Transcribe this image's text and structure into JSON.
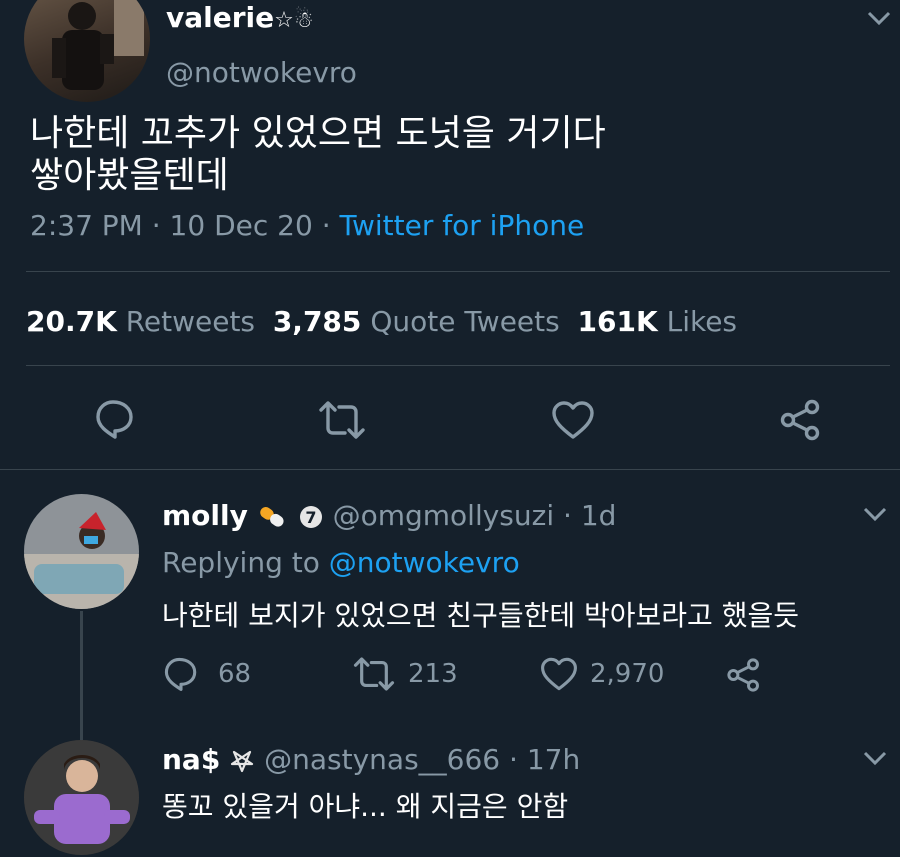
{
  "main_tweet": {
    "display_name": "valerie",
    "name_emoji": "☆☃",
    "handle": "@notwokevro",
    "text_line1": "나한테 꼬추가 있었으면 도넛을 거기다",
    "text_line2": "쌓아봤을텐데",
    "time": "2:37 PM",
    "date": "10 Dec 20",
    "source": "Twitter for iPhone",
    "separator": "·",
    "stats": {
      "retweets_count": "20.7K",
      "retweets_label": "Retweets",
      "quotes_count": "3,785",
      "quotes_label": "Quote Tweets",
      "likes_count": "161K",
      "likes_label": "Likes"
    },
    "actions": [
      "reply-icon",
      "retweet-icon",
      "like-icon",
      "share-icon"
    ]
  },
  "reply1": {
    "display_name": "molly",
    "handle": "@omgmollysuzi",
    "age": "1d",
    "separator": "·",
    "replying_label": "Replying to",
    "replying_handle": "@notwokevro",
    "text": "나한테 보지가 있었으면 친구들한테 박아보라고 했을듯",
    "replies": "68",
    "retweets": "213",
    "likes": "2,970"
  },
  "reply2": {
    "display_name": "na$",
    "handle": "@nastynas__666",
    "age": "17h",
    "separator": "·",
    "text": "똥꼬 있을거 아냐... 왜 지금은 안함"
  },
  "colors": {
    "background": "#15202b",
    "secondary_text": "#8899a6",
    "link": "#1da1f2",
    "divider": "#38444d"
  }
}
